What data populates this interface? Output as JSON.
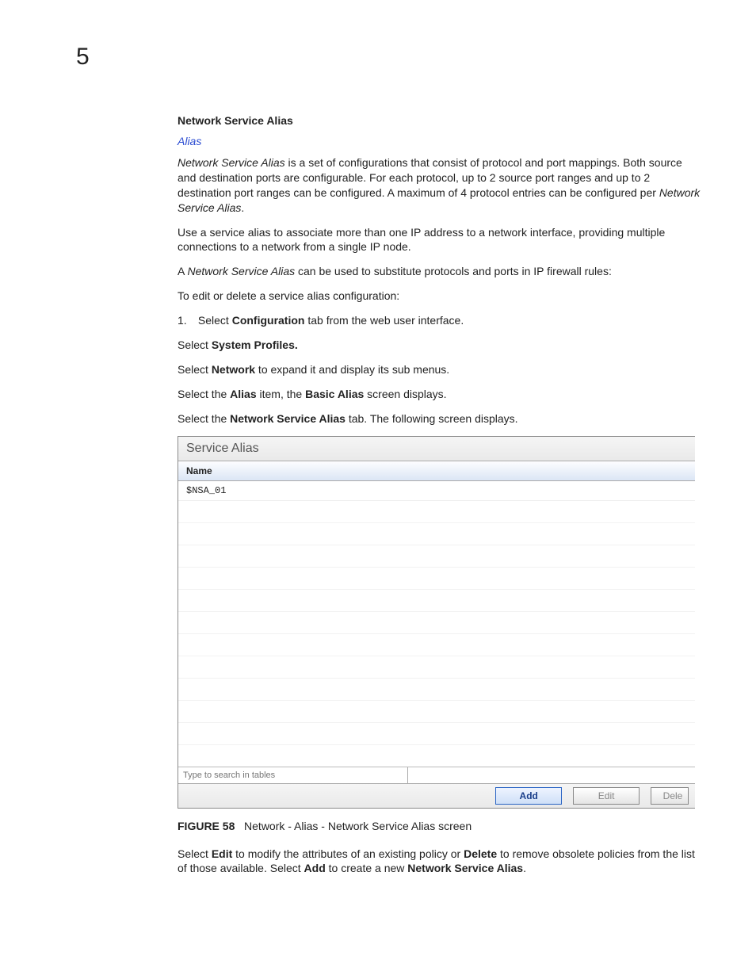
{
  "chapter": "5",
  "heading": "Network Service Alias",
  "crumb": "Alias",
  "para1": {
    "lead_it": "Network Service Alias",
    "rest1": " is a set of configurations that consist of protocol and port mappings. Both source and destination ports are configurable. For each protocol, up to 2 source port ranges and up to 2 destination port ranges can be configured. A maximum of 4 protocol entries can be configured per ",
    "tail_it": "Network Service Alias",
    "dot": "."
  },
  "para2": "Use a service alias to associate more than one IP address to a network interface, providing multiple connections to a network from a single IP node.",
  "para3": {
    "pre": "A ",
    "it": "Network Service Alias",
    "post": " can be used to substitute protocols and ports in IP firewall rules:"
  },
  "para4": "To edit or delete a service alias configuration:",
  "step1": {
    "num": "1.",
    "pre": "Select ",
    "b": "Configuration",
    "post": " tab from the web user interface."
  },
  "line2": {
    "pre": "Select ",
    "b": "System Profiles."
  },
  "line3": {
    "pre": "Select ",
    "b": "Network",
    "post": " to expand it and display its sub menus."
  },
  "line4": {
    "pre": "Select the ",
    "b1": "Alias",
    "mid": " item, the ",
    "b2": "Basic Alias",
    "post": " screen displays."
  },
  "line5": {
    "pre": "Select the ",
    "b": "Network Service Alias",
    "post": " tab. The following screen displays."
  },
  "panel": {
    "title": "Service Alias",
    "col": "Name",
    "row1": "$NSA_01",
    "search_placeholder": "Type to search in tables",
    "btn_add": "Add",
    "btn_edit": "Edit",
    "btn_delete": "Dele"
  },
  "caption": {
    "label": "FIGURE 58",
    "text": "Network - Alias - Network Service Alias screen"
  },
  "closing": {
    "pre": "Select ",
    "b1": "Edit",
    "mid1": " to modify the attributes of an existing policy or ",
    "b2": "Delete",
    "mid2": " to remove obsolete policies from the list of those available. Select ",
    "b3": "Add",
    "mid3": " to create a new ",
    "b4": "Network Service Alias",
    "dot": "."
  }
}
